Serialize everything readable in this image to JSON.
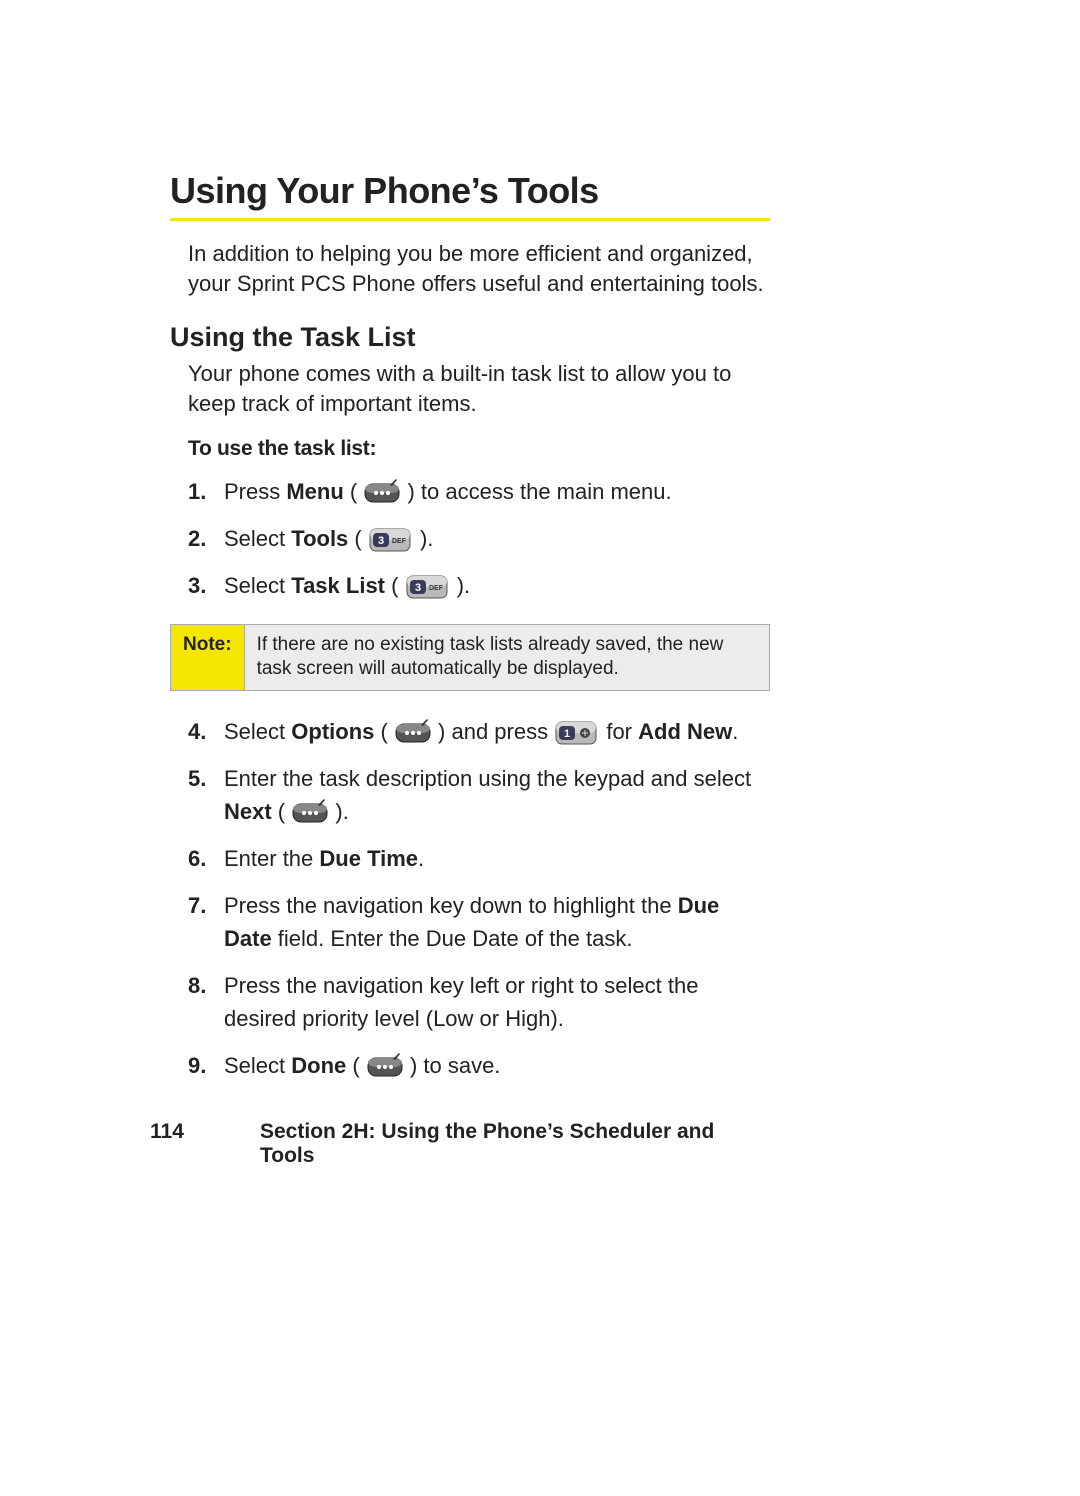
{
  "title": "Using Your Phone’s Tools",
  "intro": "In addition to helping you be more efficient and organized, your Sprint PCS Phone offers useful and entertaining tools.",
  "subhead": "Using the Task List",
  "subintro": "Your phone comes with a built-in task list to allow you to keep track of important items.",
  "proc_title": "To use the task list:",
  "steps1": {
    "s1_a": "Press ",
    "s1_b": "Menu",
    "s1_c": " ( ",
    "s1_d": " ) to access the main menu.",
    "s2_a": "Select ",
    "s2_b": "Tools",
    "s2_c": " ( ",
    "s2_d": " ).",
    "s3_a": "Select ",
    "s3_b": "Task List",
    "s3_c": " ( ",
    "s3_d": " )."
  },
  "note": {
    "label": "Note:",
    "text": "If there are no existing task lists already saved, the new task screen will automatically be displayed."
  },
  "steps2": {
    "s4_a": "Select ",
    "s4_b": "Options",
    "s4_c": " ( ",
    "s4_d": " ) and press ",
    "s4_e": " for ",
    "s4_f": "Add New",
    "s4_g": ".",
    "s5_a": "Enter the task description using the keypad and select ",
    "s5_b": "Next",
    "s5_c": " ( ",
    "s5_d": " ).",
    "s6_a": "Enter the ",
    "s6_b": "Due Time",
    "s6_c": ".",
    "s7_a": "Press the navigation key down to highlight the ",
    "s7_b": "Due Date",
    "s7_c": " field. Enter the Due Date of the task.",
    "s8": "Press the navigation key left or right to select the desired priority level (Low or High).",
    "s9_a": "Select ",
    "s9_b": "Done",
    "s9_c": " ( ",
    "s9_d": " ) to save."
  },
  "footer": {
    "page": "114",
    "text": "Section 2H: Using the Phone’s Scheduler and Tools"
  }
}
